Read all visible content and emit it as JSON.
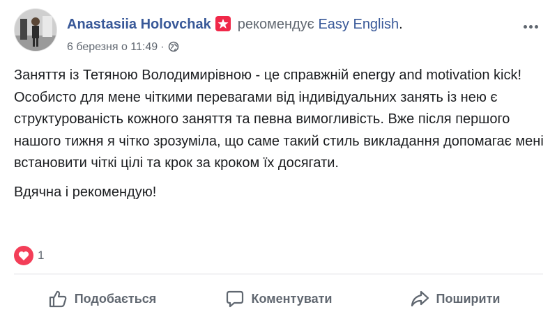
{
  "post": {
    "author_name": "Anastasiia Holovchak",
    "recommends_text": "рекомендує",
    "page_name": "Easy English",
    "page_name_suffix": ".",
    "date": "6 березня о 11:49",
    "separator": "·",
    "privacy_icon": "globe-icon",
    "badge_icon": "star-badge-icon",
    "more_icon": "more-options-icon",
    "paragraphs": [
      "Заняття із Тетяною Володимирівною - це справжній energy and motivation kick! Особисто для мене чіткими перевагами від індивідуальних занять із нею є структурованість кожного заняття та певна вимогливість. Вже після першого нашого тижня я чітко зрозуміла, що саме такий стиль викладання допомагає мені встановити чіткі цілі та крок за кроком їх досягати.",
      "Вдячна і рекомендую!"
    ]
  },
  "reactions": {
    "icon": "heart-icon",
    "count": "1"
  },
  "actions": {
    "like_label": "Подобається",
    "comment_label": "Коментувати",
    "share_label": "Поширити"
  },
  "colors": {
    "link": "#385898",
    "secondary_text": "#606770",
    "badge": "#f02849",
    "heart": "#f33e58",
    "divider": "#dadde1"
  }
}
